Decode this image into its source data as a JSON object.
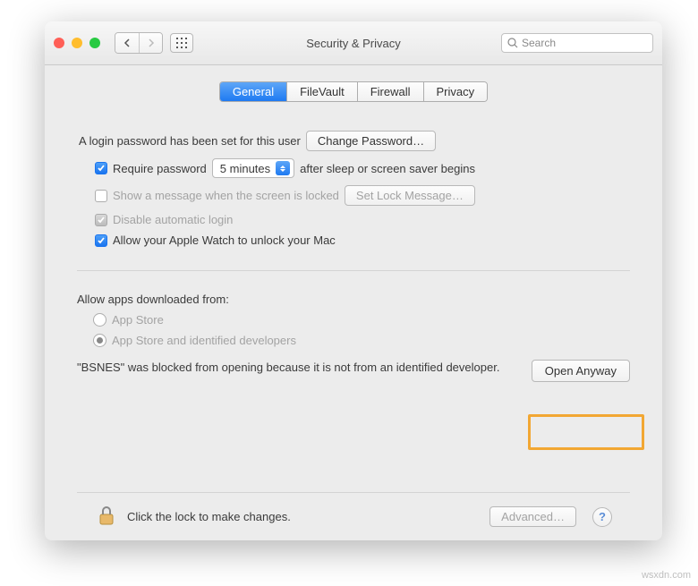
{
  "window": {
    "title": "Security & Privacy",
    "search_placeholder": "Search"
  },
  "tabs": {
    "general": "General",
    "filevault": "FileVault",
    "firewall": "Firewall",
    "privacy": "Privacy"
  },
  "login": {
    "set_text": "A login password has been set for this user",
    "change_button": "Change Password…",
    "require_label": "Require password",
    "delay_value": "5 minutes",
    "after_text": "after sleep or screen saver begins",
    "show_message_label": "Show a message when the screen is locked",
    "set_lock_button": "Set Lock Message…",
    "disable_auto_label": "Disable automatic login",
    "apple_watch_label": "Allow your Apple Watch to unlock your Mac"
  },
  "allow": {
    "heading": "Allow apps downloaded from:",
    "opt1": "App Store",
    "opt2": "App Store and identified developers",
    "blocked_msg": "\"BSNES\" was blocked from opening because it is not from an identified developer.",
    "open_anyway": "Open Anyway"
  },
  "footer": {
    "lock_text": "Click the lock to make changes.",
    "advanced": "Advanced…",
    "help": "?"
  },
  "watermark": "wsxdn.com"
}
